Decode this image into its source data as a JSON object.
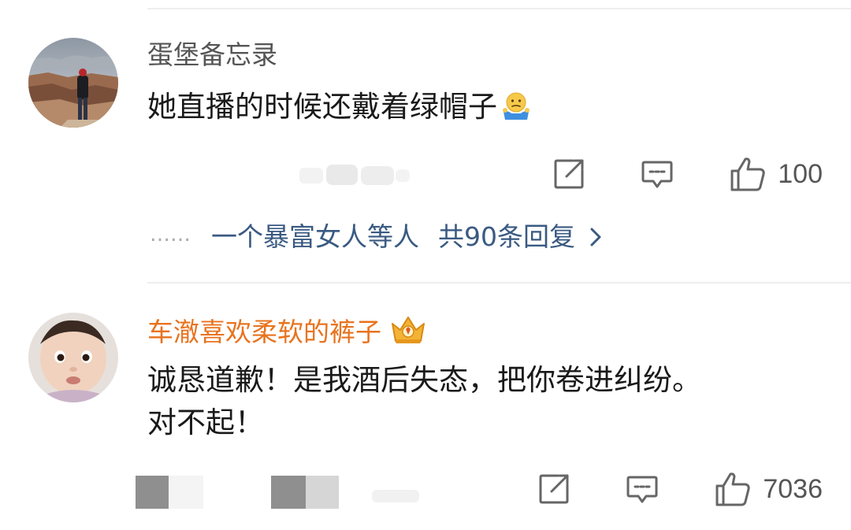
{
  "comments": [
    {
      "username": "蛋堡备忘录",
      "text": "她直播的时候还戴着绿帽子",
      "emoji_icon": "shrug-emoji-icon",
      "likes": "100",
      "replies": {
        "dots": "……",
        "preview_user": "一个暴富女人等人",
        "total": "共90条回复"
      }
    },
    {
      "username": "车澈喜欢柔软的裤子",
      "badge_icon": "crown-badge-icon",
      "text_line1": "诚恳道歉！是我酒后失态，把你卷进纠纷。",
      "text_line2": "对不起！",
      "likes": "7036"
    }
  ],
  "colors": {
    "vip_name": "#e8731e",
    "link": "#3a5a82",
    "name": "#555555",
    "text": "#1a1a1a"
  }
}
